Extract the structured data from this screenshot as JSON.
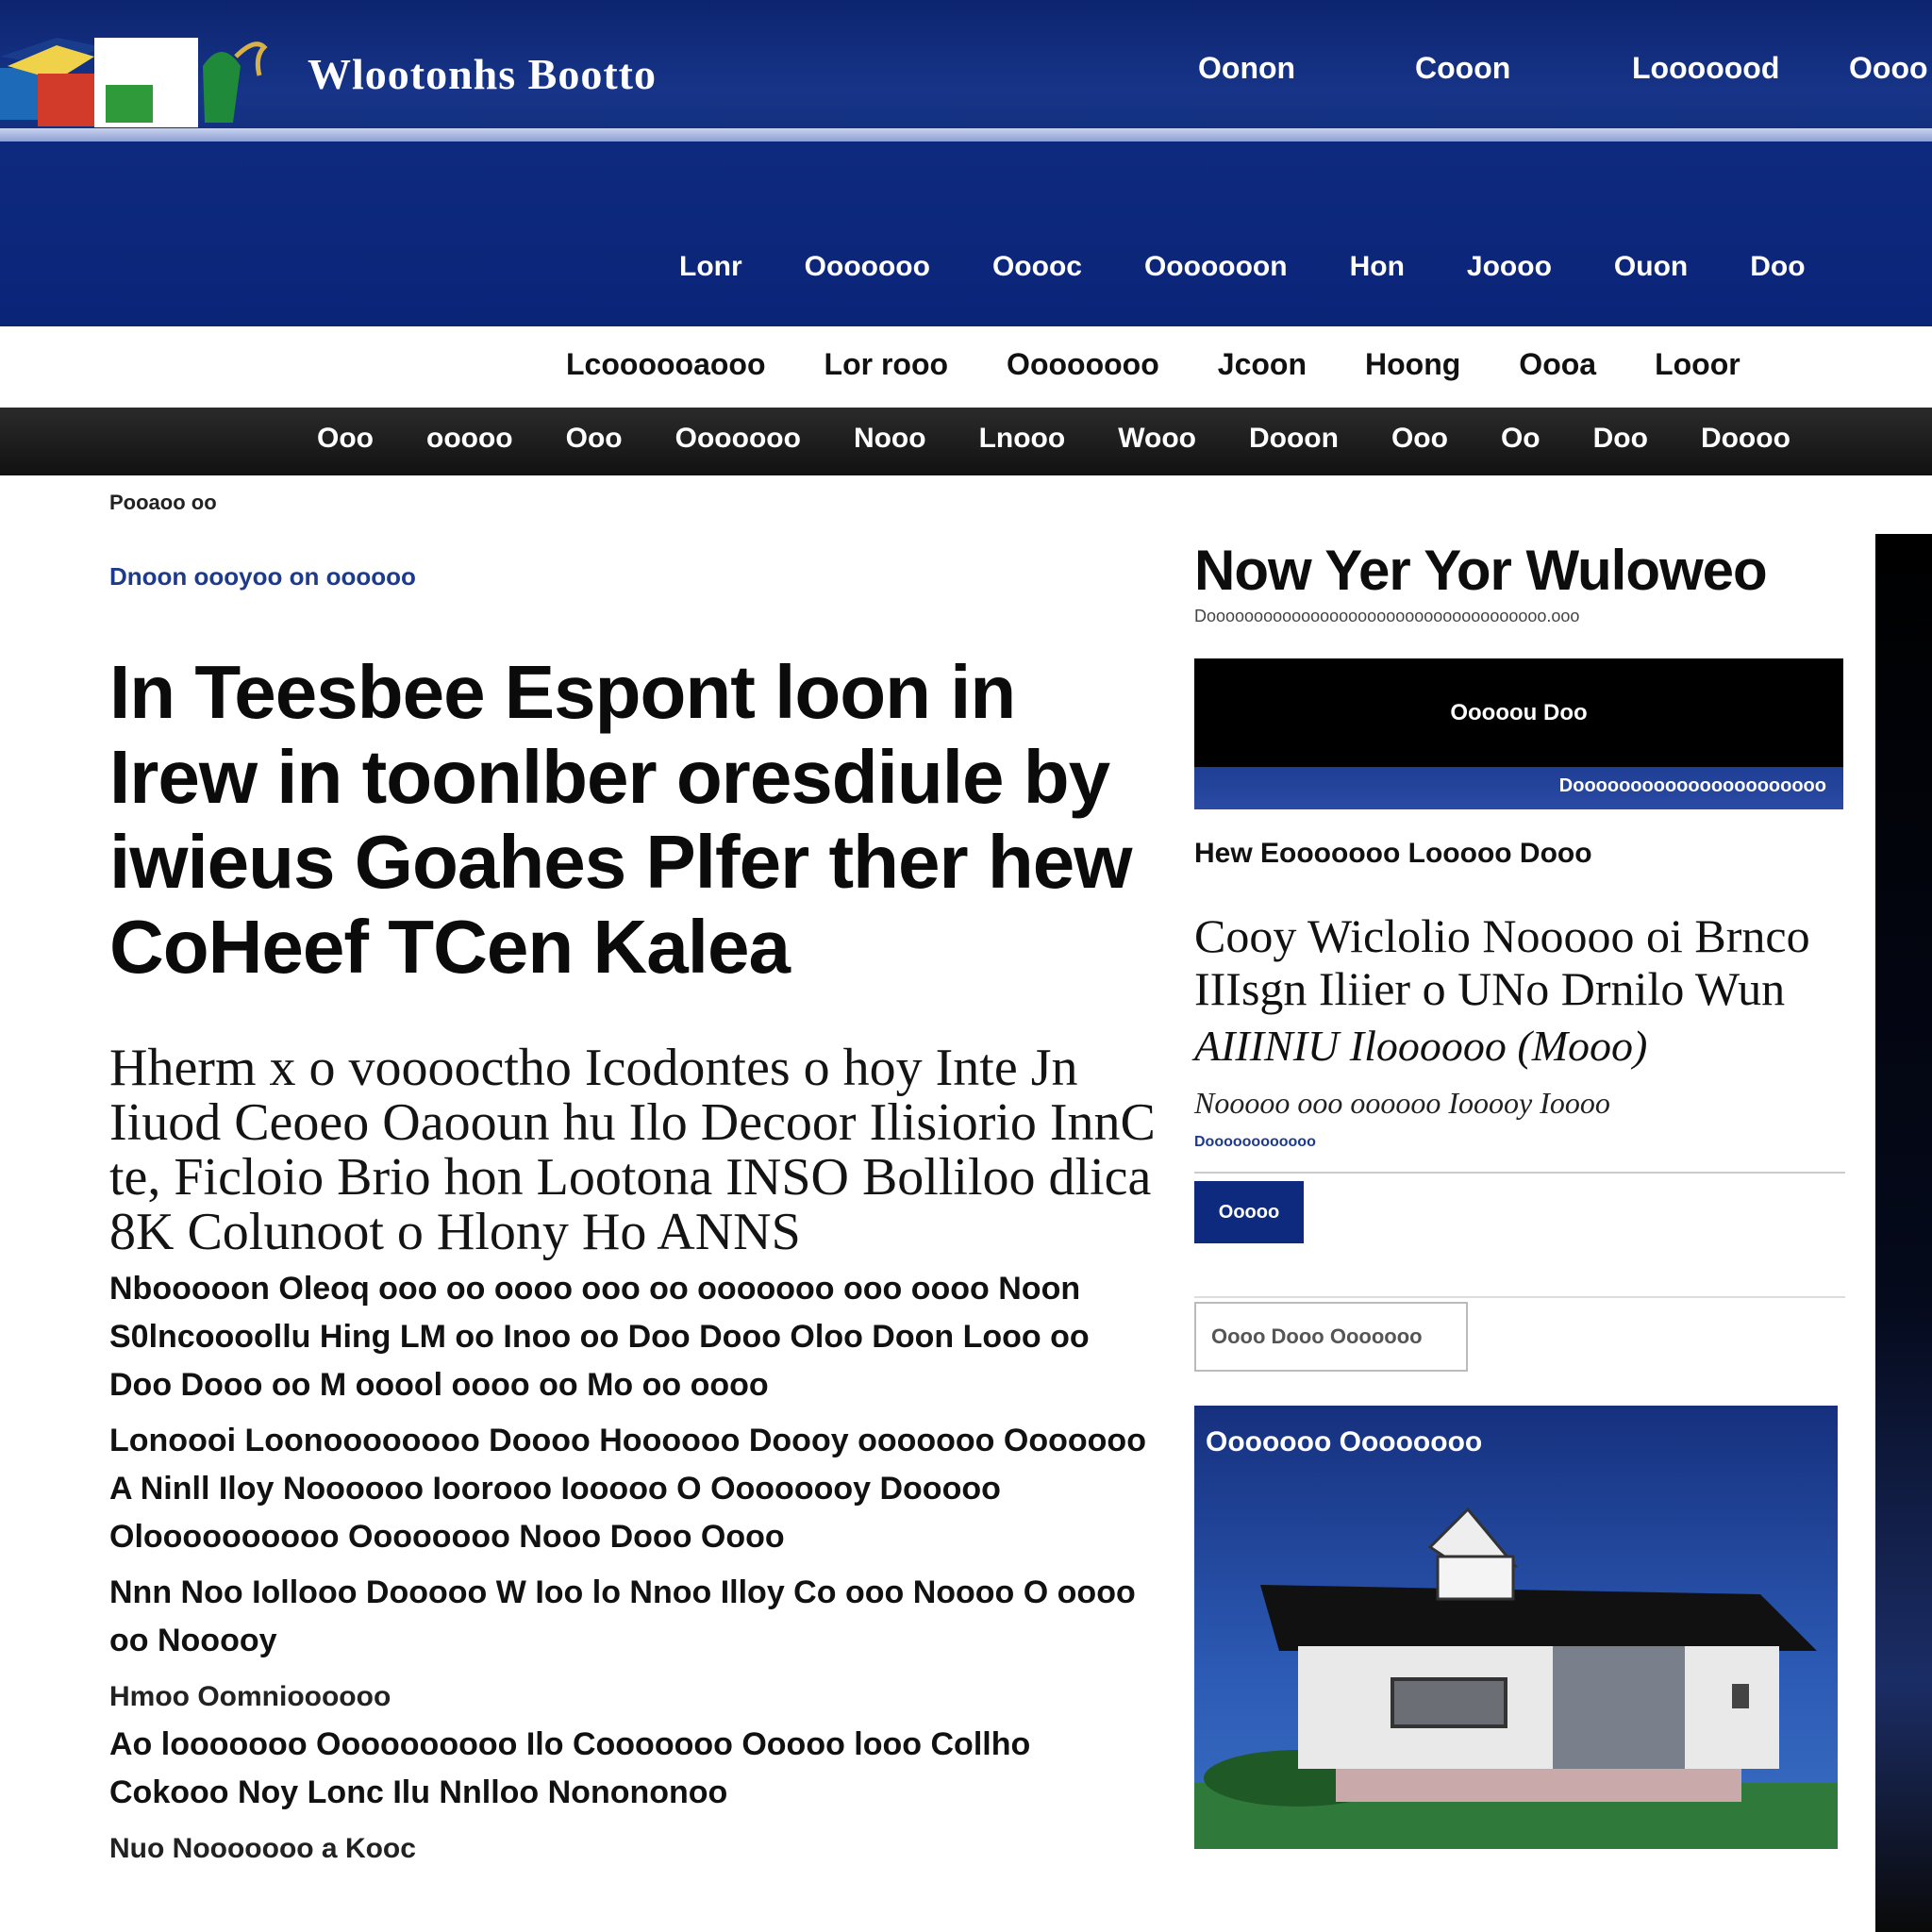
{
  "header": {
    "site_name": "Wlootonhs Bootto",
    "top_nav": [
      "Oonon",
      "Cooon",
      "Looooood",
      "Oooo"
    ]
  },
  "main_nav": [
    "Lonr",
    "Ooooooo",
    "Ooooc",
    "Ooooooon",
    "Hon",
    "Joooo",
    "Ouon",
    "Doo"
  ],
  "sub_nav": [
    "Lcoooooaooo",
    "Lor rooo",
    "Oooooooo",
    "Jcoon",
    "Hoong",
    "Oooa",
    "Looor"
  ],
  "black_nav": [
    "Ooo",
    "ooooo",
    "Ooo",
    "Ooooooo",
    "Nooo",
    "Lnooo",
    "Wooo",
    "Dooon",
    "Ooo",
    "Oo",
    "Doo",
    "Doooo"
  ],
  "article": {
    "breadcrumb": "Pooaoo oo",
    "kicker": "Dnoon oooyoo on oooooo",
    "headline": "In Teesbee Espont loon in Irew in toonlber oresdiule by iwieus Goahes Plfer ther hew CoHeef TCen Kalea",
    "lede": "Hherm x o vooooctho Icodontes o hoy Inte Jn Iiuod Ceoeo Oaooun hu Ilo Decoor Ilisiorio InnC te, Ficloio Brio hon Lootona INSO Bolliloo dlica 8K Colunoot o Hlony Ho ANNS",
    "paragraphs": [
      "Nbooooon Oleoq ooo oo oooo ooo oo ooooooo ooo oooo Noon S0lncoooollu Hing LM oo Inoo oo Doo Dooo Oloo Doon Looo oo Doo Dooo oo M ooool oooo oo Mo oo oooo",
      "Lonoooi Loonoooooooo Doooo Hoooooo Doooy ooooooo Ooooooo A Ninll Iloy Noooooo Ioorooo Iooooo O Oooooooy Dooooo Oloooooooooo Oooooooo Nooo Dooo Oooo",
      "Nnn Noo Iollooo Dooooo W Ioo lo Nnoo Illoy Co ooo Noooo O oooo oo Nooooy"
    ],
    "dateline1": "Hmoo Oomnioooooo",
    "closing": "Ao looooooo Oooooooooo Ilo Cooooooo Ooooo looo Collho Cokooo Noy Lonc Ilu Nnlloo Nonononoo",
    "footer_note": "Nuo Nooooooo a Kooc"
  },
  "sidebar": {
    "title": "Now Yer Yor Wuloweo",
    "subtitle": "Doooooooooooooooooooooooooooooooooooo.ooo",
    "box_title": "Ooooou Doo",
    "box_sub": "Doooooooooooooooooooooo",
    "section_label": "Hew Eooooooo Looooo Dooo",
    "story_headline": "Cooy Wiclolio Nooooo oi Brnco IIIsgn Iliier o UNo Drnilo Wun",
    "story_byline": "AIIINIU Iloooooo (Mooo)",
    "story_meta": "Nooooo ooo oooooo Iooooy Ioooo",
    "tags": "Doooooooooooo",
    "button_label": "Ooooo",
    "search_placeholder": "Oooo Dooo Ooooooo",
    "promo_title": "Ooooooo Oooooooo"
  },
  "colors": {
    "header_blue": "#12307f",
    "nav_blue": "#0e2a7e",
    "black_nav": "#1a1a1a",
    "link_blue": "#1d3a8c"
  }
}
